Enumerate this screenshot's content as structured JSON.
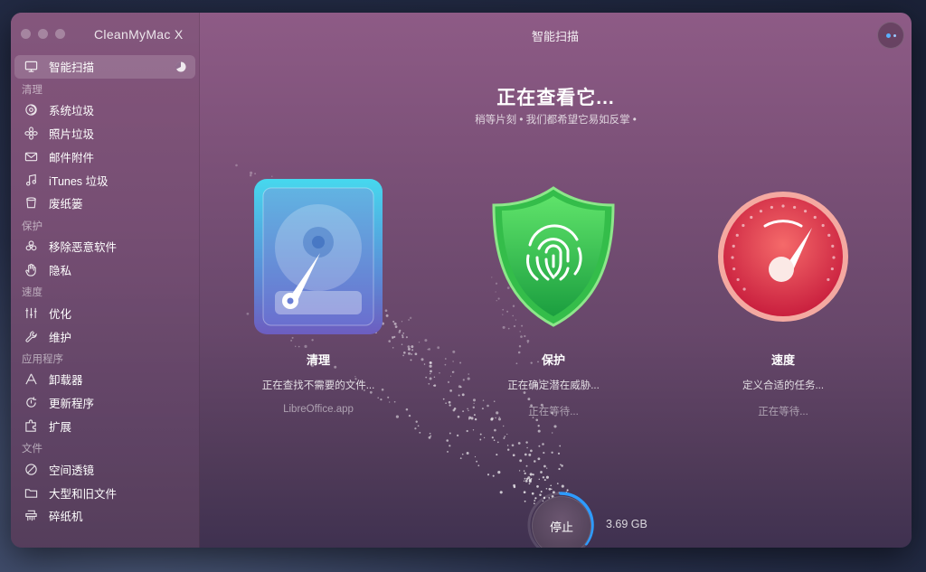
{
  "window": {
    "app_title": "CleanMyMac X",
    "page_title": "智能扫描"
  },
  "sidebar": {
    "top_item": {
      "label": "智能扫描",
      "icon": "monitor-icon"
    },
    "sections": [
      {
        "title": "清理",
        "items": [
          {
            "label": "系统垃圾",
            "icon": "trash-swirl-icon"
          },
          {
            "label": "照片垃圾",
            "icon": "flower-icon"
          },
          {
            "label": "邮件附件",
            "icon": "envelope-icon"
          },
          {
            "label": "iTunes 垃圾",
            "icon": "music-note-icon"
          },
          {
            "label": "废纸篓",
            "icon": "trash-bin-icon"
          }
        ]
      },
      {
        "title": "保护",
        "items": [
          {
            "label": "移除恶意软件",
            "icon": "biohazard-icon"
          },
          {
            "label": "隐私",
            "icon": "hand-icon"
          }
        ]
      },
      {
        "title": "速度",
        "items": [
          {
            "label": "优化",
            "icon": "sliders-icon"
          },
          {
            "label": "维护",
            "icon": "wrench-icon"
          }
        ]
      },
      {
        "title": "应用程序",
        "items": [
          {
            "label": "卸载器",
            "icon": "uninstaller-icon"
          },
          {
            "label": "更新程序",
            "icon": "update-icon"
          },
          {
            "label": "扩展",
            "icon": "extension-icon"
          }
        ]
      },
      {
        "title": "文件",
        "items": [
          {
            "label": "空间透镜",
            "icon": "lens-icon"
          },
          {
            "label": "大型和旧文件",
            "icon": "folder-icon"
          },
          {
            "label": "碎纸机",
            "icon": "shredder-icon"
          }
        ]
      }
    ]
  },
  "main": {
    "headline": "正在查看它...",
    "subline": "稍等片刻 • 我们都希望它易如反掌 •",
    "modules": [
      {
        "title": "清理",
        "status": "正在查找不需要的文件...",
        "detail": "LibreOffice.app",
        "icon": "hard-drive-icon"
      },
      {
        "title": "保护",
        "status": "正在确定潜在威胁...",
        "detail": "正在等待...",
        "icon": "fingerprint-shield-icon"
      },
      {
        "title": "速度",
        "status": "定义合适的任务...",
        "detail": "正在等待...",
        "icon": "speedometer-icon"
      }
    ],
    "stop_label": "停止",
    "scanned_size": "3.69 GB",
    "progress": 0.35
  },
  "colors": {
    "accent": "#2e9bff",
    "clean": "#4fc7e6",
    "protect": "#3fcf4a",
    "speed": "#e8384f"
  }
}
